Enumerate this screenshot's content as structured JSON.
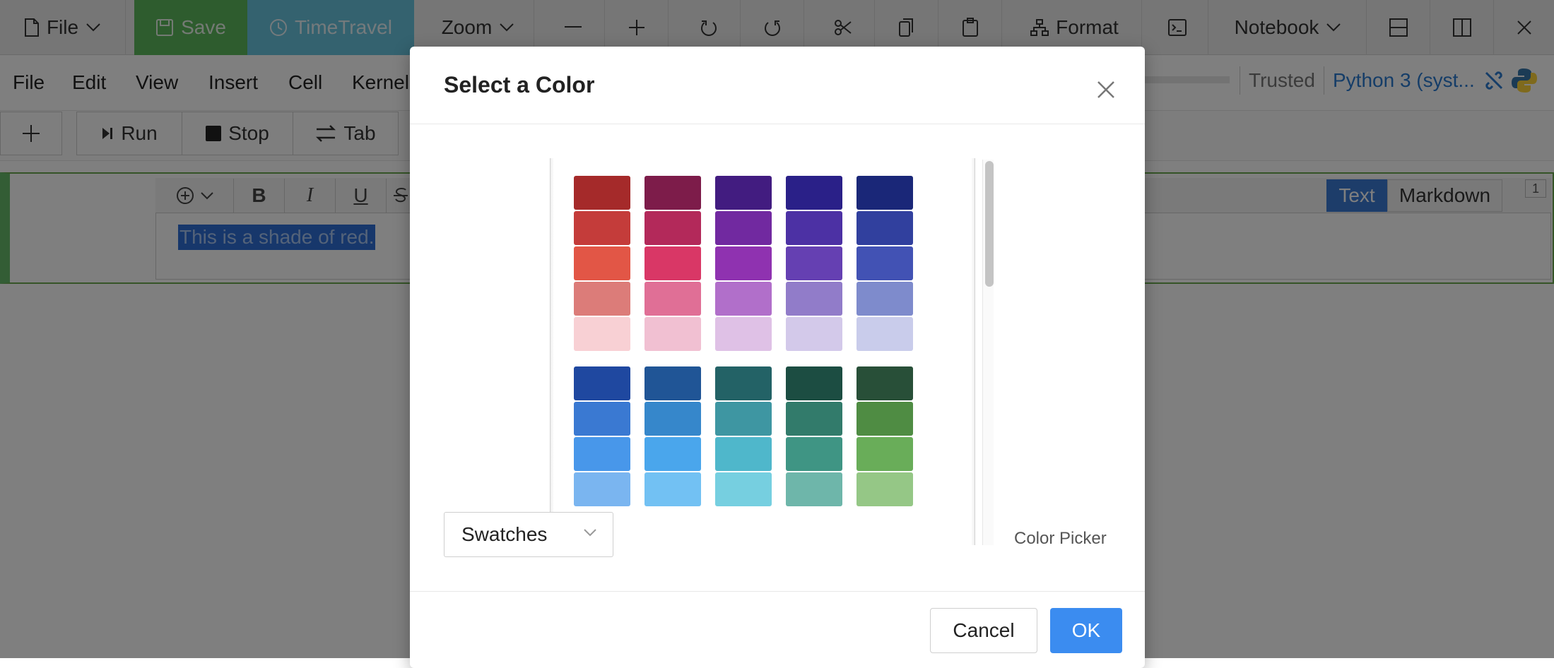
{
  "toolbar": {
    "file_label": "File",
    "save_label": "Save",
    "timetravel_label": "TimeTravel",
    "zoom_label": "Zoom",
    "format_label": "Format",
    "notebook_label": "Notebook",
    "colors": {
      "save_bg": "#5cb85c",
      "timetravel_bg": "#5bc0de"
    }
  },
  "menubar": {
    "items": [
      "File",
      "Edit",
      "View",
      "Insert",
      "Cell",
      "Kernel"
    ],
    "trusted_label": "Trusted",
    "kernel_label": "Python 3 (syst..."
  },
  "cell_toolbar": {
    "add_label": "+",
    "run_label": "Run",
    "stop_label": "Stop",
    "tab_label": "Tab"
  },
  "cell": {
    "selected_text": "This is a shade of red.",
    "mode_text_label": "Text",
    "mode_markdown_label": "Markdown",
    "cell_number": "1",
    "format_buttons": [
      "B",
      "I",
      "U"
    ]
  },
  "dialog": {
    "title": "Select a Color",
    "mode_selected": "Swatches",
    "color_picker_label": "Color Picker",
    "cancel_label": "Cancel",
    "ok_label": "OK",
    "ok_color": "#3b8cf0",
    "swatch_groups": [
      {
        "columns": [
          [
            "#a52a2a",
            "#c43c3a",
            "#e25646",
            "#dc7c79",
            "#f8d0d4"
          ],
          [
            "#7d1c4a",
            "#b3295a",
            "#d93766",
            "#e06f96",
            "#f1c0d2"
          ],
          [
            "#421c80",
            "#7129a0",
            "#8f32b0",
            "#b16fca",
            "#dfc1e6"
          ],
          [
            "#2a2088",
            "#4c31a4",
            "#6540b2",
            "#917cc9",
            "#d3c9ea"
          ],
          [
            "#1a2778",
            "#31409e",
            "#4252b4",
            "#7e8bcc",
            "#c9cceb"
          ]
        ]
      },
      {
        "columns": [
          [
            "#1f48a0",
            "#3a79d2",
            "#4897ea",
            "#7ab5f0"
          ],
          [
            "#205596",
            "#3687cb",
            "#4aa6ec",
            "#72c1f3"
          ],
          [
            "#236266",
            "#3e96a2",
            "#4fb7cb",
            "#76cfe0"
          ],
          [
            "#1c4d42",
            "#327b6b",
            "#3f9584",
            "#6eb6aa"
          ],
          [
            "#284f38",
            "#4f8c43",
            "#69ad59",
            "#95c786"
          ]
        ]
      }
    ]
  }
}
